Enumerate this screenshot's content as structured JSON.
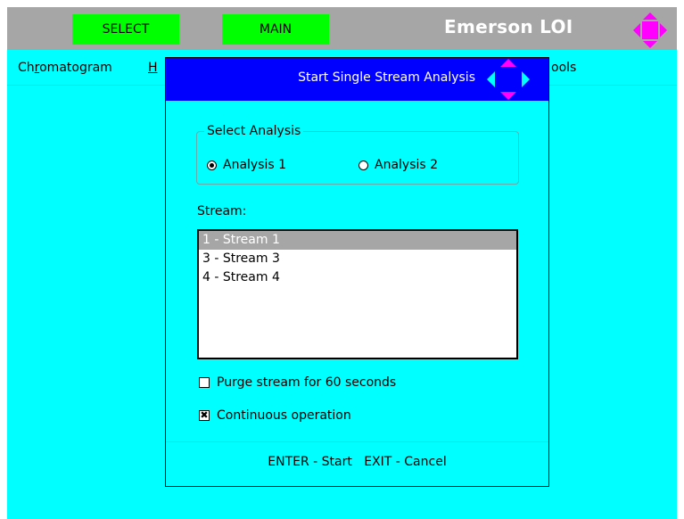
{
  "topbar": {
    "select_label": "SELECT",
    "main_label": "MAIN",
    "brand": "Emerson LOI",
    "nav_icon": "navigation-diamond-icon"
  },
  "menubar": {
    "chromatogram_prefix": "Ch",
    "chromatogram_underlined": "r",
    "chromatogram_suffix": "omatogram",
    "hidden_item_initial": "H",
    "tools_partial": "ools"
  },
  "dialog": {
    "title": "Start Single Stream Analysis",
    "select_analysis_legend": "Select Analysis",
    "analysis_options": [
      {
        "label": "Analysis 1",
        "selected": true
      },
      {
        "label": "Analysis 2",
        "selected": false
      }
    ],
    "stream_label": "Stream:",
    "streams": [
      {
        "label": "1 - Stream 1",
        "selected": true
      },
      {
        "label": "3 - Stream 3",
        "selected": false
      },
      {
        "label": "4 - Stream 4",
        "selected": false
      }
    ],
    "purge_label": "Purge stream for 60 seconds",
    "purge_checked": false,
    "continuous_label": "Continuous operation",
    "continuous_checked": true,
    "footer": "ENTER - Start   EXIT - Cancel"
  },
  "colors": {
    "background": "#00ffff",
    "topbar": "#a6a6a6",
    "button_green": "#00ff00",
    "title_blue": "#0000ff",
    "nav_magenta": "#ff00ff"
  }
}
